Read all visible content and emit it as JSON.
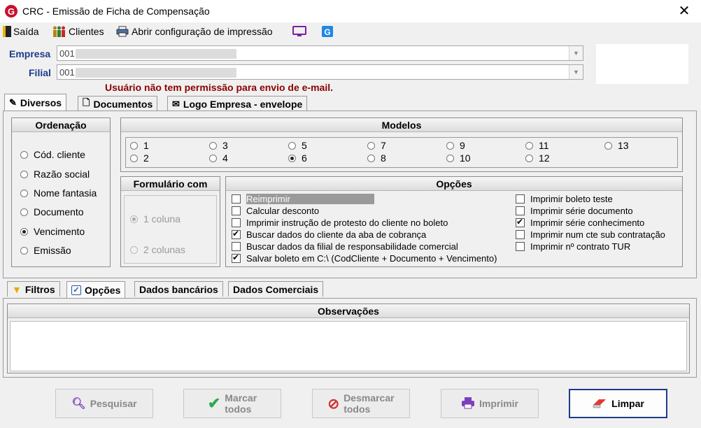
{
  "window": {
    "title": "CRC - Emissão de Ficha de Compensação"
  },
  "toolbar": {
    "exit": "Saída",
    "clients": "Clientes",
    "print_config": "Abrir configuração de impressão"
  },
  "form": {
    "empresa_label": "Empresa",
    "empresa_value": "001",
    "filial_label": "Filial",
    "filial_value": "001",
    "warning": "Usuário não tem permissão para envio de e-mail."
  },
  "top_tabs": [
    "Diversos",
    "Documentos",
    "Logo Empresa - envelope"
  ],
  "ordenacao": {
    "title": "Ordenação",
    "options": [
      "Cód. cliente",
      "Razão social",
      "Nome fantasia",
      "Documento",
      "Vencimento",
      "Emissão"
    ],
    "selected": "Vencimento"
  },
  "modelos": {
    "title": "Modelos",
    "row1": [
      "1",
      "3",
      "5",
      "7",
      "9",
      "11",
      "13"
    ],
    "row2": [
      "2",
      "4",
      "6",
      "8",
      "10",
      "12"
    ],
    "selected": "6"
  },
  "formulario": {
    "title": "Formulário com",
    "options": [
      "1 coluna",
      "2 colunas"
    ],
    "selected": "1 coluna"
  },
  "opcoes": {
    "title": "Opções",
    "left": [
      {
        "label": "Reimprimir",
        "checked": false
      },
      {
        "label": "Calcular desconto",
        "checked": false
      },
      {
        "label": "Imprimir instrução de protesto do cliente no boleto",
        "checked": false
      },
      {
        "label": "Buscar dados do cliente da aba de cobrança",
        "checked": true
      },
      {
        "label": "Buscar dados da filial de responsabilidade comercial",
        "checked": false
      },
      {
        "label": "Salvar boleto em C:\\ (CodCliente + Documento + Vencimento)",
        "checked": true
      }
    ],
    "right": [
      {
        "label": "Imprimir boleto teste",
        "checked": false
      },
      {
        "label": "Imprimir série documento",
        "checked": false
      },
      {
        "label": "Imprimir série conhecimento",
        "checked": true
      },
      {
        "label": "Imprimir num cte sub contratação",
        "checked": false
      },
      {
        "label": "Imprimir nº contrato TUR",
        "checked": false
      }
    ]
  },
  "bottom_tabs": [
    "Filtros",
    "Opções",
    "Dados bancários",
    "Dados Comerciais"
  ],
  "observacoes": {
    "title": "Observações"
  },
  "buttons": {
    "pesquisar": "Pesquisar",
    "marcar_1": "Marcar",
    "marcar_2": "todos",
    "desmarcar_1": "Desmarcar",
    "desmarcar_2": "todos",
    "imprimir": "Imprimir",
    "limpar": "Limpar"
  },
  "colors": {
    "accent": "#1f3a8a",
    "warning": "#8b0000",
    "logo_red": "#c8102e"
  }
}
